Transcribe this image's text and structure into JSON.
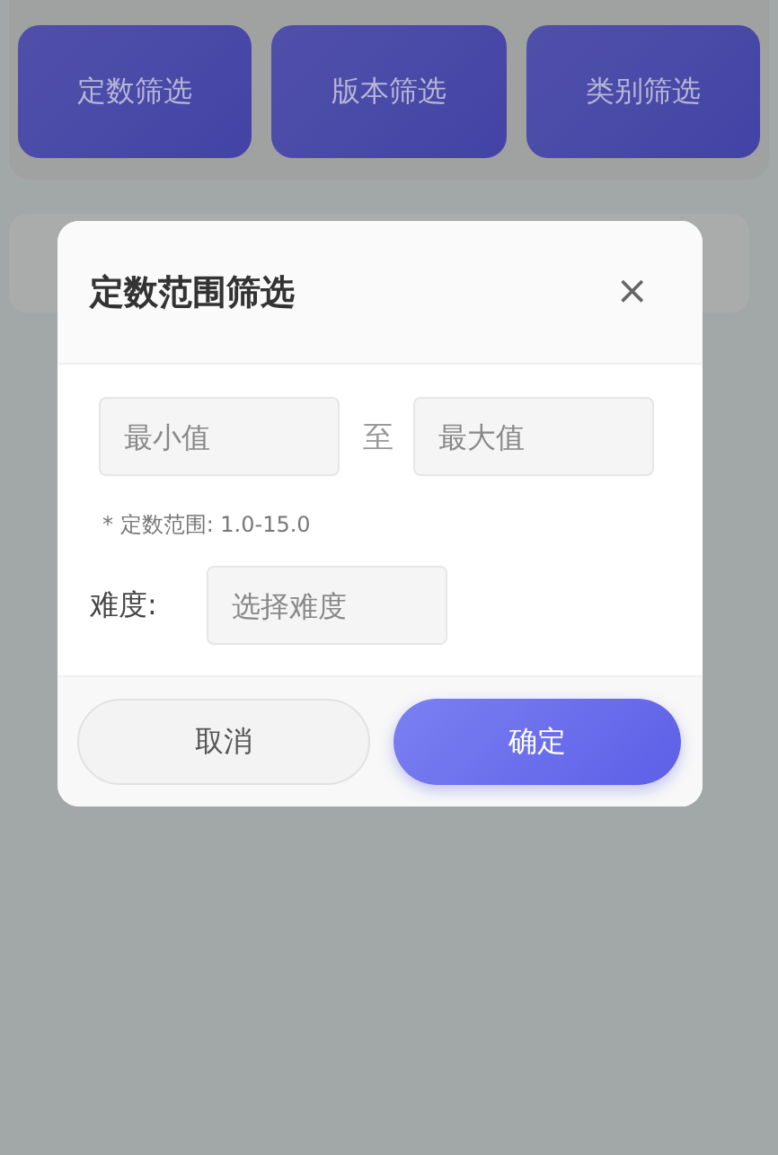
{
  "filter_buttons": [
    {
      "label": "定数筛选"
    },
    {
      "label": "版本筛选"
    },
    {
      "label": "类别筛选"
    }
  ],
  "dialog": {
    "title": "定数范围筛选",
    "close": "×",
    "min_field": {
      "placeholder": "最小值"
    },
    "separator": "至",
    "max_field": {
      "placeholder": "最大值"
    },
    "hint": "* 定数范围: 1.0-15.0",
    "difficulty_label": "难度:",
    "difficulty_select": {
      "placeholder": "选择难度"
    },
    "buttons": [
      {
        "label": "取消",
        "kind": "cancel"
      },
      {
        "label": "确定",
        "kind": "confirm"
      }
    ]
  }
}
